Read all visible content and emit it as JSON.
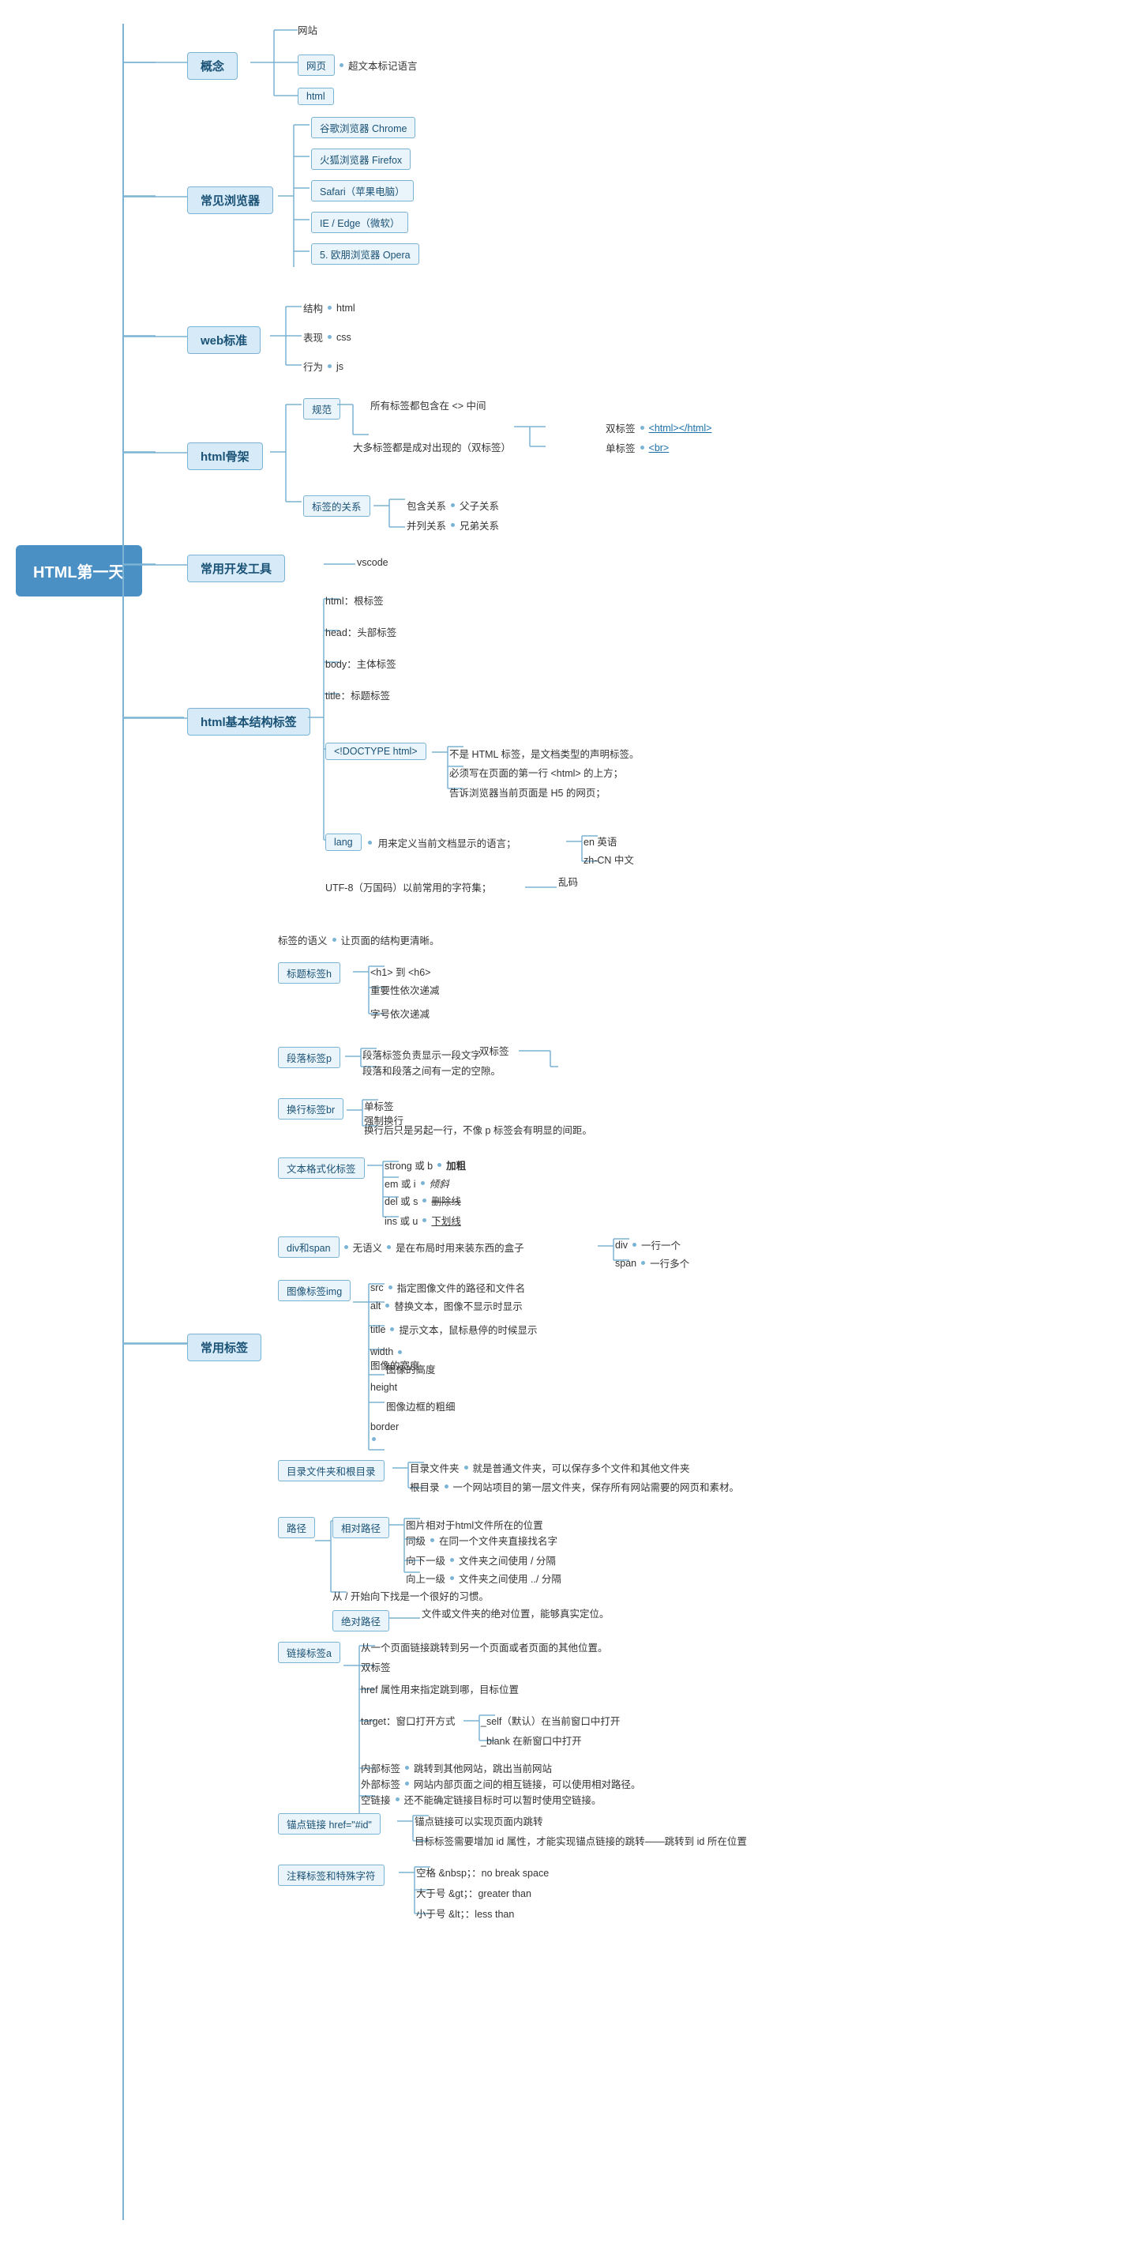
{
  "title": "HTML第一天",
  "sections": {
    "gainian": {
      "label": "概念",
      "items": [
        "网站",
        "网页  ◇  超文本标记语言",
        "html"
      ]
    },
    "browsers": {
      "label": "常见浏览器",
      "items": [
        "谷歌浏览器 Chrome",
        "火狐浏览器 Firefox",
        "Safari（苹果电脑）",
        "IE / Edge（微软）",
        "5. 欧朋浏览器 Opera"
      ]
    },
    "webStandard": {
      "label": "web标准",
      "items": [
        "结构  ◇  html",
        "表现  ◇  css",
        "行为  ◇  js"
      ]
    },
    "htmlSkeleton": {
      "label": "html骨架",
      "rules": "规范",
      "rule1": "所有标签都包含在 <> 中间",
      "rule2": "大多标签都是成对出现的（双标签）",
      "doubleTag": "双标签  ◇  <html></html>",
      "singleTag": "单标签  ◇  <br>",
      "tagRelation": "标签的关系",
      "contain": "包含关系  ◇  父子关系",
      "parallel": "并列关系  ◇  兄弟关系"
    },
    "devTools": {
      "label": "常用开发工具",
      "item": "vscode"
    },
    "htmlBasic": {
      "label": "html基本结构标签",
      "items": [
        "html：根标签",
        "head：头部标签",
        "body：主体标签",
        "title：标题标签"
      ],
      "doctype": "<!DOCTYPE html>",
      "doctypeDesc": [
        "不是 HTML 标签，是文档类型的声明标签。",
        "必须写在页面的第一行 <html> 的上方；",
        "告诉浏览器当前页面是 H5 的网页；"
      ],
      "lang": "lang",
      "langDesc": "用来定义当前文档显示的语言；",
      "langEn": "en 英语",
      "langZh": "zh-CN 中文",
      "utf8": "UTF-8（万国码）以前常用的字符集；",
      "utf8Sub": "乱码"
    },
    "commonTags": {
      "label": "常用标签",
      "semantics": "标签的语义  ◇  让页面的结构更清晰。",
      "h": {
        "label": "标题标签h",
        "h1h6": "<h1> 到 <h6>",
        "items": [
          "重要性依次递减",
          "字号依次递减"
        ]
      },
      "p": {
        "label": "段落标签p",
        "desc": "段落标签负责显示一段文字",
        "type": "双标签",
        "note": "段落和段落之间有一定的空隙。"
      },
      "br": {
        "label": "换行标签br",
        "type": "单标签",
        "desc": "强制换行",
        "note": "换行后只是另起一行，不像 p 标签会有明显的间距。"
      },
      "format": {
        "label": "文本格式化标签",
        "items": [
          "strong 或 b  ◇  加粗",
          "em 或 i  ◇  倾斜",
          "del 或 s  ◇  删除线",
          "ins 或 u  ◇  下划线"
        ]
      },
      "divspan": {
        "label": "div和span",
        "desc": "无语义  ◇  是在布局时用来装东西的盒子",
        "div": "div  ◇  一行一个",
        "span": "span  ◇  一行多个"
      },
      "img": {
        "label": "图像标签img",
        "attrs": [
          "src  ◇  指定图像文件的路径和文件名",
          "alt  ◇  替换文本，图像不显示时显示",
          "title  ◇  提示文本，鼠标悬停的时候显示",
          "width  ◇  图像的宽度",
          "height  ◇  图像的高度",
          "border  ◇  图像边框的粗细"
        ]
      },
      "directory": {
        "label": "目录文件夹和根目录",
        "folder": "目录文件夹  ◇  就是普通文件夹，可以保存多个文件和其他文件夹",
        "root": "根目录  ◇  一个网站项目的第一层文件夹，保存所有网站需要的网页和素材。"
      },
      "path": {
        "label": "路径",
        "relative": {
          "label": "相对路径",
          "desc": "图片相对于html文件所在的位置",
          "items": [
            "同级  ◇  在同一个文件夹直接找名字",
            "向下一级  ◇  文件夹之间使用 / 分隔",
            "向上一级  ◇  文件夹之间使用 ../ 分隔"
          ],
          "habit": "从 / 开始向下找是一个很好的习惯。"
        },
        "absolute": {
          "label": "绝对路径",
          "desc": "文件或文件夹的绝对位置，能够真实定位。"
        }
      },
      "anchor": {
        "label": "链接标签a",
        "desc": "从一个页面链接跳转到另一个页面或者页面的其他位置。",
        "type": "双标签",
        "href": "href 属性用来指定跳到哪，目标位置",
        "target": "target：窗口打开方式",
        "targetItems": [
          "_self（默认）在当前窗口中打开",
          "_blank 在新窗口中打开"
        ],
        "internal": "内部标签  ◇  跳转到其他网站，跳出当前网站",
        "external": "外部标签  ◇  网站内部页面之间的相互链接，可以使用相对路径。",
        "empty": "空链接  ◇  还不能确定链接目标时可以暂时使用空链接。"
      },
      "anchorPoint": {
        "label": "锚点链接 href=\"#id\"",
        "desc": "锚点链接可以实现页面内跳转",
        "note": "目标标签需要增加 id 属性，才能实现锚点链接的跳转——跳转到 id 所在位置"
      },
      "special": {
        "label": "注释标签和特殊字符",
        "items": [
          "空格 &nbsp；：no break space",
          "大于号 &gt；：greater than",
          "小于号 &lt；：less than"
        ]
      }
    }
  }
}
